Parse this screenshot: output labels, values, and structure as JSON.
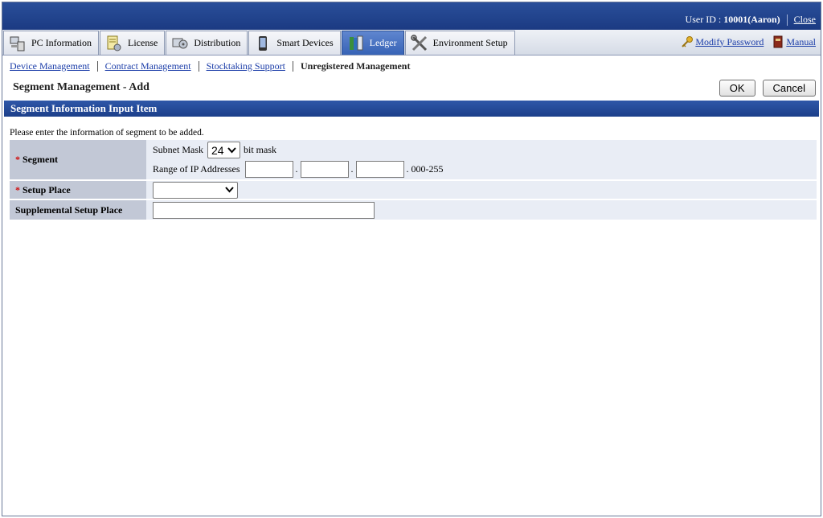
{
  "header": {
    "user_id_label": "User ID : ",
    "user_id_value": "10001(Aaron)",
    "close_label": "Close"
  },
  "tabs": [
    {
      "label": "PC Information",
      "icon": "pc-icon"
    },
    {
      "label": "License",
      "icon": "license-icon"
    },
    {
      "label": "Distribution",
      "icon": "distribution-icon"
    },
    {
      "label": "Smart Devices",
      "icon": "smart-device-icon"
    },
    {
      "label": "Ledger",
      "icon": "ledger-icon",
      "active": true
    },
    {
      "label": "Environment Setup",
      "icon": "tools-icon"
    }
  ],
  "top_links": {
    "modify_password": "Modify Password",
    "manual": "Manual"
  },
  "subnav": {
    "device_management": "Device Management",
    "contract_management": "Contract Management",
    "stocktaking_support": "Stocktaking Support",
    "unregistered_management": "Unregistered Management"
  },
  "page": {
    "title": "Segment Management - Add",
    "ok_label": "OK",
    "cancel_label": "Cancel"
  },
  "section": {
    "title": "Segment Information Input Item",
    "intro": "Please enter the information of segment to be added."
  },
  "form": {
    "required_mark": "*",
    "segment_label": "Segment",
    "subnet_mask_label": "Subnet Mask",
    "subnet_mask_value": "24",
    "bit_mask_label": "bit mask",
    "ip_range_label": "Range of IP Addresses",
    "ip_dot": ".",
    "ip_range_hint": ". 000-255",
    "ip_octet_1": "",
    "ip_octet_2": "",
    "ip_octet_3": "",
    "setup_place_label": "Setup Place",
    "setup_place_value": "",
    "supplemental_label": "Supplemental Setup Place",
    "supplemental_value": ""
  },
  "colors": {
    "header_blue": "#1b3a82",
    "active_tab": "#3763b6",
    "link": "#1a3ca8",
    "required": "#d01010"
  }
}
